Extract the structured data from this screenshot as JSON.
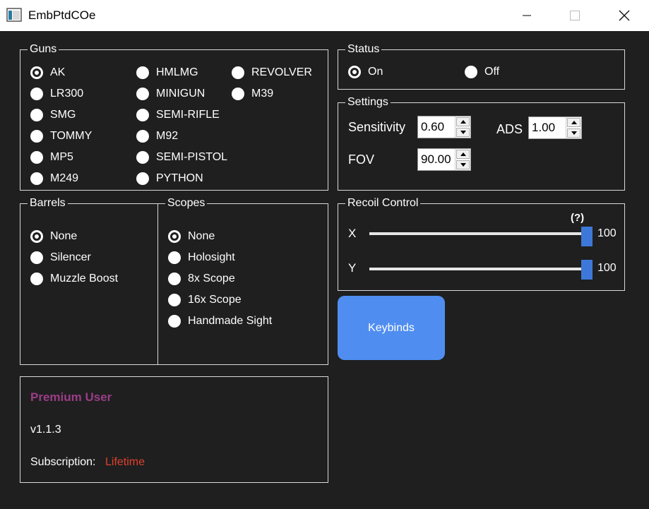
{
  "window": {
    "title": "EmbPtdCOe"
  },
  "guns": {
    "legend": "Guns",
    "items": [
      {
        "label": "AK",
        "checked": true
      },
      {
        "label": "LR300",
        "checked": false
      },
      {
        "label": "SMG",
        "checked": false
      },
      {
        "label": "TOMMY",
        "checked": false
      },
      {
        "label": "MP5",
        "checked": false
      },
      {
        "label": "M249",
        "checked": false
      },
      {
        "label": "HMLMG",
        "checked": false
      },
      {
        "label": "MINIGUN",
        "checked": false
      },
      {
        "label": "SEMI-RIFLE",
        "checked": false
      },
      {
        "label": "M92",
        "checked": false
      },
      {
        "label": "SEMI-PISTOL",
        "checked": false
      },
      {
        "label": "PYTHON",
        "checked": false
      },
      {
        "label": "REVOLVER",
        "checked": false
      },
      {
        "label": "M39",
        "checked": false
      }
    ]
  },
  "barrels": {
    "legend": "Barrels",
    "items": [
      {
        "label": "None",
        "checked": true
      },
      {
        "label": "Silencer",
        "checked": false
      },
      {
        "label": "Muzzle Boost",
        "checked": false
      }
    ]
  },
  "scopes": {
    "legend": "Scopes",
    "items": [
      {
        "label": "None",
        "checked": true
      },
      {
        "label": "Holosight",
        "checked": false
      },
      {
        "label": "8x Scope",
        "checked": false
      },
      {
        "label": "16x Scope",
        "checked": false
      },
      {
        "label": "Handmade Sight",
        "checked": false
      }
    ]
  },
  "status": {
    "legend": "Status",
    "on_label": "On",
    "off_label": "Off",
    "on_checked": true
  },
  "settings": {
    "legend": "Settings",
    "sensitivity_label": "Sensitivity",
    "sensitivity_value": "0.60",
    "ads_label": "ADS",
    "ads_value": "1.00",
    "fov_label": "FOV",
    "fov_value": "90.00"
  },
  "recoil": {
    "legend": "Recoil Control",
    "help": "(?)",
    "x_label": "X",
    "x_value": "100",
    "x_fraction": 1.0,
    "y_label": "Y",
    "y_value": "100",
    "y_fraction": 1.0
  },
  "keybinds_label": "Keybinds",
  "account": {
    "tier": "Premium User",
    "version": "v1.1.3",
    "subscription_label": "Subscription:",
    "subscription_value": "Lifetime"
  },
  "colors": {
    "background": "#1f1f1f",
    "accent": "#4f8ef0",
    "slider_thumb": "#3d78d8",
    "premium": "#9b3d87",
    "subscription": "#e0412e"
  },
  "icons": {
    "app": "app-window-icon",
    "minimize": "minimize-icon",
    "maximize": "maximize-icon",
    "close": "close-icon",
    "spin_up": "triangle-up-icon",
    "spin_down": "triangle-down-icon"
  }
}
